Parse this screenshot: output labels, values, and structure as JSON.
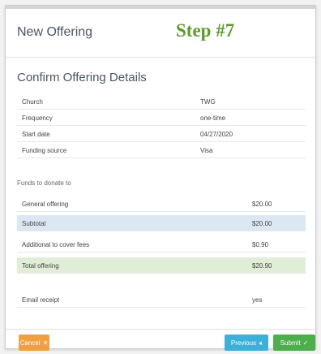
{
  "header": {
    "title": "New Offering",
    "step": "Step #7"
  },
  "section_title": "Confirm Offering Details",
  "details": [
    {
      "label": "Church",
      "value": "TWG"
    },
    {
      "label": "Frequency",
      "value": "one-time"
    },
    {
      "label": "Start date",
      "value": "04/27/2020"
    },
    {
      "label": "Funding source",
      "value": "Visa"
    }
  ],
  "funds_heading": "Funds to donate to",
  "funds": [
    {
      "label": "General offering",
      "value": "$20.00"
    },
    {
      "label": "Subtotal",
      "value": "$20.00"
    },
    {
      "label": "Additional to cover fees",
      "value": "$0.90"
    },
    {
      "label": "Total offering",
      "value": "$20.90"
    }
  ],
  "email_receipt": {
    "label": "Email receipt",
    "value": "yes"
  },
  "buttons": {
    "cancel": "Cancel",
    "previous": "Previous",
    "submit": "Submit"
  },
  "colors": {
    "step_text": "#5f9a2c",
    "cancel": "#f0a040",
    "previous": "#3cb0d8",
    "submit": "#4cae4c",
    "subtotal_row": "#dbe8f3",
    "total_row": "#e0eed8"
  }
}
